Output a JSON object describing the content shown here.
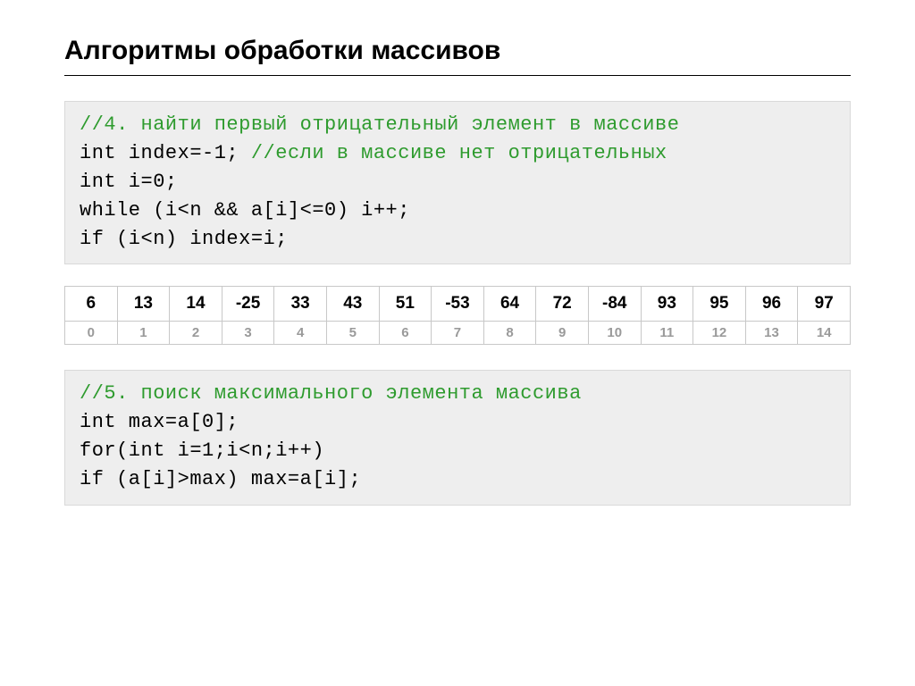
{
  "title": "Алгоритмы обработки массивов",
  "code1": {
    "c1": "//4. найти первый отрицательный элемент в массиве",
    "l2a": "int index=-1; ",
    "c2": "//если в массиве нет отрицательных",
    "l3": "int i=0;",
    "l4": "while (i<n && a[i]<=0) i++;",
    "l5": "if (i<n) index=i;"
  },
  "table": {
    "values": [
      "6",
      "13",
      "14",
      "-25",
      "33",
      "43",
      "51",
      "-53",
      "64",
      "72",
      "-84",
      "93",
      "95",
      "96",
      "97"
    ],
    "indices": [
      "0",
      "1",
      "2",
      "3",
      "4",
      "5",
      "6",
      "7",
      "8",
      "9",
      "10",
      "11",
      "12",
      "13",
      "14"
    ]
  },
  "code2": {
    "c1": "//5. поиск максимального элемента массива",
    "l2": "int max=a[0];",
    "l3": "for(int i=1;i<n;i++)",
    "l4": "if (a[i]>max) max=a[i];"
  }
}
